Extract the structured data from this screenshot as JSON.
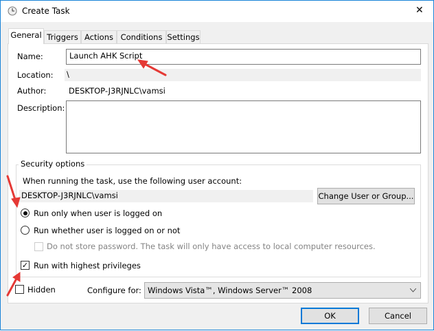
{
  "window": {
    "title": "Create Task",
    "close_glyph": "✕"
  },
  "tabs": [
    {
      "label": "General",
      "selected": true
    },
    {
      "label": "Triggers"
    },
    {
      "label": "Actions"
    },
    {
      "label": "Conditions"
    },
    {
      "label": "Settings"
    }
  ],
  "general": {
    "name_label": "Name:",
    "name_value": "Launch AHK Script",
    "location_label": "Location:",
    "location_value": "\\",
    "author_label": "Author:",
    "author_value": "DESKTOP-J3RJNLC\\vamsi",
    "description_label": "Description:",
    "description_value": ""
  },
  "security": {
    "legend": "Security options",
    "account_prompt": "When running the task, use the following user account:",
    "account_value": "DESKTOP-J3RJNLC\\vamsi",
    "change_button": "Change User or Group...",
    "radio_logged_on": "Run only when user is logged on",
    "radio_whether": "Run whether user is logged on or not",
    "no_store_password": "Do not store password.  The task will only have access to local computer resources.",
    "highest_privileges": "Run with highest privileges",
    "highest_checked": true,
    "selected_radio": "logged_on"
  },
  "hidden_label": "Hidden",
  "hidden_checked": false,
  "configure_label": "Configure for:",
  "configure_value": "Windows Vista™, Windows Server™ 2008",
  "ok_label": "OK",
  "cancel_label": "Cancel",
  "colors": {
    "accent": "#1883d7",
    "annotation_arrow": "#e53935"
  }
}
